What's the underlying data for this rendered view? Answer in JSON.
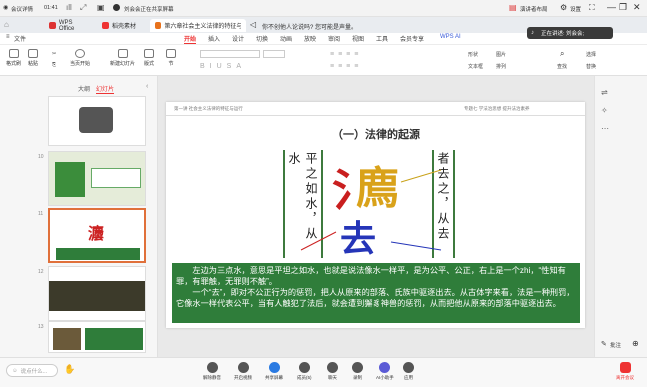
{
  "meeting_bar": {
    "audio_label": "会议详情",
    "time": "01:41",
    "sharing_label": "刘会会正在共享屏幕",
    "speaker_mode": "演讲者布局",
    "settings": "设置"
  },
  "tabs": [
    {
      "label": "WPS Office"
    },
    {
      "label": "稻壳素材"
    },
    {
      "label": "第六章社会主义法律的特征与运"
    }
  ],
  "notification": "你不创他人论说吗? 您可能是声量。",
  "ribbon_tabs": [
    "文件",
    "开始",
    "插入",
    "设计",
    "切换",
    "动画",
    "放映",
    "审阅",
    "视图",
    "工具",
    "会员专享",
    "WPS AI"
  ],
  "ribbon": {
    "buttons": [
      {
        "label": "格式刷"
      },
      {
        "label": "粘贴"
      },
      {
        "label": "当页开始"
      },
      {
        "label": "新建幻灯片"
      },
      {
        "label": "版式"
      },
      {
        "label": "节"
      }
    ],
    "right_buttons": [
      "形状",
      "图片",
      "排列",
      "文本框",
      "查找",
      "选择",
      "替换"
    ]
  },
  "speaker_badge": "正在讲述: 刘会会;",
  "left_panel": {
    "tabs": [
      "大纲",
      "幻灯片"
    ],
    "slide_numbers": [
      "10",
      "11",
      "12",
      "13"
    ]
  },
  "slide": {
    "header_left": "第一讲  社会主义法律的特征与运行",
    "header_right": "专题七  学法治思想  提升法治素养",
    "title": "（一）法律的起源",
    "left_vertical": "平之如水，从水",
    "right_vertical": "者去之，从去",
    "right_vertical_last": "去",
    "body": "　　左边为三点水，意思是平坦之如水，也就是说法像水一样平，是为公平、公正，右上是一个zhi，“性知有罪，有罪触，无罪则不触”。\n　　一个“去”，即对不公正行为的惩罚，把人从原来的部落、氏族中驱逐出去。从古体字来看，法是一种刑罚，它像水一样代表公平，当有人触犯了法后，就会遭到獬豸神兽的惩罚，从而把他从原来的部落中驱逐出去。"
  },
  "right_strip": {
    "annotate": "批注"
  },
  "bottom_bar": {
    "input_placeholder": "说点什么...",
    "items": [
      "解除静音",
      "开启视频",
      "共享屏幕",
      "成员(5)",
      "聊天",
      "录制",
      "AI小助手",
      "应用"
    ],
    "end_label": "离开会议"
  }
}
